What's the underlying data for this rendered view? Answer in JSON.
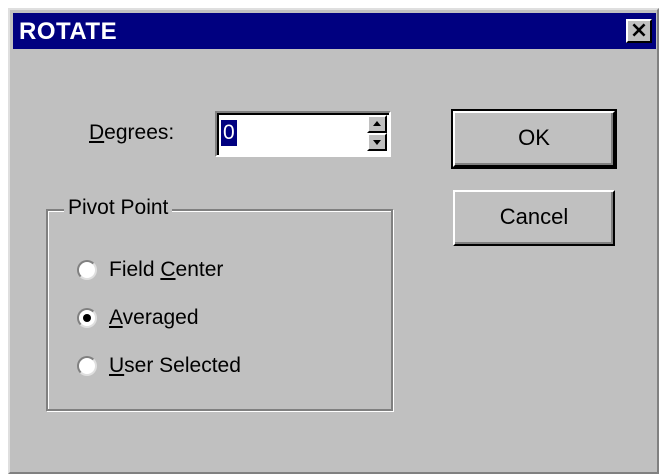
{
  "window": {
    "title": "ROTATE",
    "close_label": "×"
  },
  "degrees": {
    "label_accel": "D",
    "label_rest": "egrees:",
    "value": "0"
  },
  "buttons": {
    "ok_label": "OK",
    "cancel_label": "Cancel"
  },
  "pivot": {
    "title": "Pivot Point",
    "options": [
      {
        "label_pre": "Field ",
        "label_accel": "C",
        "label_post": "enter",
        "selected": false
      },
      {
        "label_pre": "",
        "label_accel": "A",
        "label_post": "veraged",
        "selected": true
      },
      {
        "label_pre": "",
        "label_accel": "U",
        "label_post": "ser Selected",
        "selected": false
      }
    ]
  },
  "colors": {
    "titlebar": "#000080",
    "dialog_face": "#c0c0c0"
  }
}
